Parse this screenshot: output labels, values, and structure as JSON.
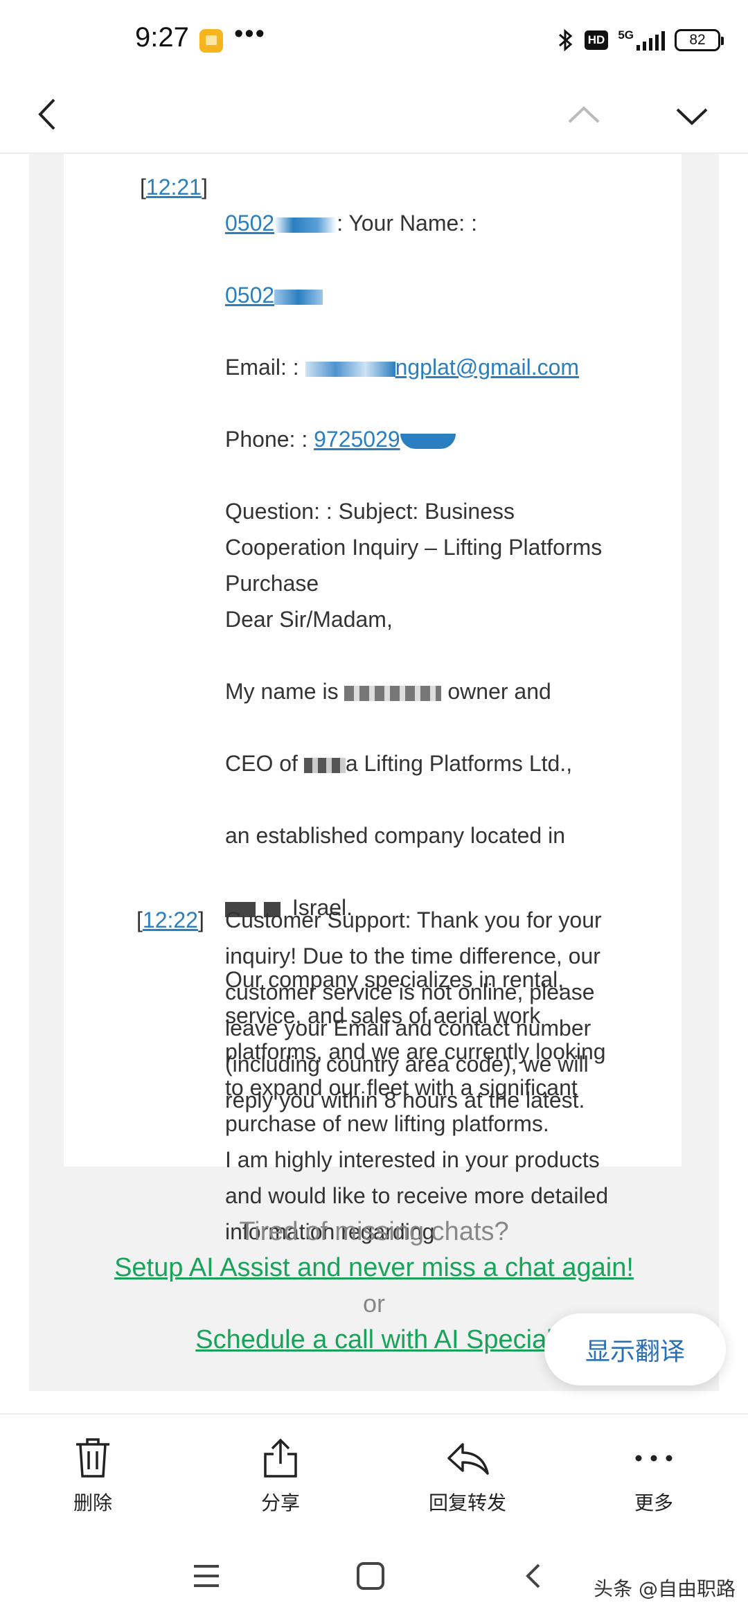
{
  "status_bar": {
    "time": "9:27",
    "dots": "•••",
    "hd": "HD",
    "network": "5G",
    "battery": "82"
  },
  "message1": {
    "time": "12:21",
    "lines": {
      "l1_phone": "0502",
      "l1_rest": ": Your Name: :",
      "l2_phone": "0502",
      "email_label": "Email: : ",
      "email_link": "ngplat@gmail.com",
      "phone_label": "Phone: : ",
      "phone_link": "9725029",
      "body1": "Question: : Subject: Business\nCooperation Inquiry – Lifting Platforms\nPurchase\nDear Sir/Madam,",
      "name_pre": "My name is ",
      "name_post": " owner and",
      "ceo_pre": "CEO of ",
      "ceo_post": "a Lifting Platforms Ltd.,",
      "established": "an established company located in",
      "israel": "Israel.",
      "body2": "Our company specializes in rental,\nservice, and sales of aerial work\nplatforms, and we are currently looking\nto expand our fleet with a significant\npurchase of new lifting platforms.\nI am highly interested in your products\nand would like to receive more detailed\ninformation regarding"
    }
  },
  "message2": {
    "time": "12:22",
    "text": "Customer Support: Thank you for your\ninquiry! Due to the time difference, our\ncustomer service is not online, please\nleave your Email and contact number\n(including country area code), we will\nreply you within 8 hours at the latest."
  },
  "promo": {
    "question": "Tired of missing chats?",
    "setup_link": "Setup AI Assist and never miss a chat again!",
    "or": "or",
    "schedule_link": "Schedule a call with AI Special"
  },
  "translate_button": "显示翻译",
  "actions": {
    "delete": "删除",
    "share": "分享",
    "reply_forward": "回复转发",
    "more": "更多"
  },
  "watermark": "头条 @自由职路",
  "colors": {
    "link_blue": "#2a7fc0",
    "promo_green": "#19a35a",
    "translate_blue": "#2a6fb5"
  }
}
